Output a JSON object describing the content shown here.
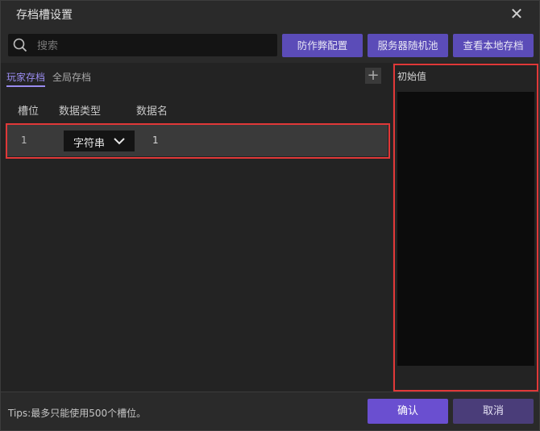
{
  "window": {
    "title": "存档槽设置"
  },
  "search": {
    "placeholder": "搜索",
    "value": ""
  },
  "toolbar": {
    "anti_cheat_label": "防作弊配置",
    "server_random_pool_label": "服务器随机池",
    "view_local_saves_label": "查看本地存档"
  },
  "tabs": [
    {
      "label": "玩家存档",
      "active": true
    },
    {
      "label": "全局存档",
      "active": false
    }
  ],
  "add_icon": "plus-icon",
  "table": {
    "headers": [
      "槽位",
      "数据类型",
      "数据名"
    ],
    "rows": [
      {
        "slot": "1",
        "type": "字符串",
        "name": "1"
      }
    ]
  },
  "detail": {
    "initial_value_label": "初始值"
  },
  "footer": {
    "tips": "Tips:最多只能使用500个槽位。",
    "confirm_label": "确认",
    "cancel_label": "取消"
  },
  "colors": {
    "accent": "#5b4cb8",
    "confirm": "#6a4fd0",
    "cancel": "#4a3d79",
    "highlight": "#e03838",
    "active_tab": "#9a8cf0"
  }
}
